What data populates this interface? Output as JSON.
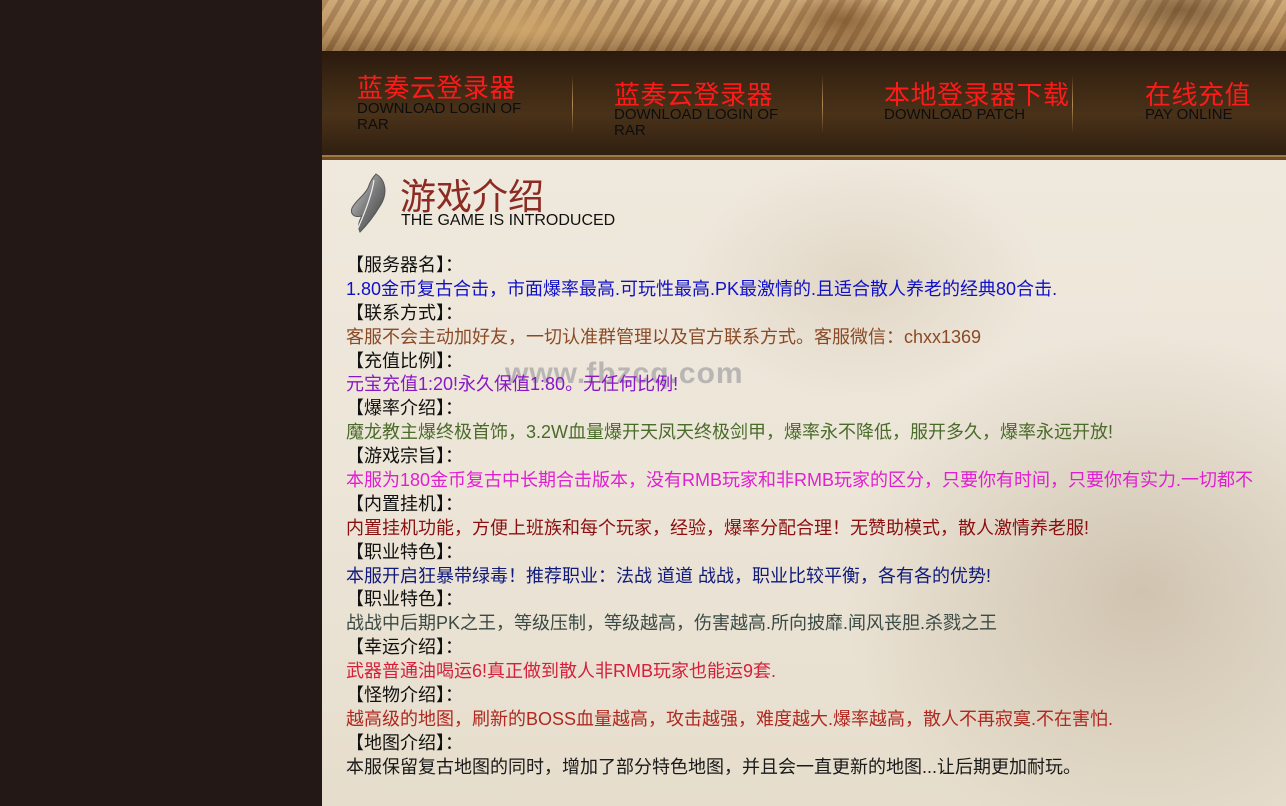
{
  "nav": {
    "items": [
      {
        "title": "蓝奏云登录器",
        "sub": "DOWNLOAD LOGIN OF RAR"
      },
      {
        "title": "蓝奏云登录器",
        "sub": "DOWNLOAD LOGIN OF RAR"
      },
      {
        "title": "本地登录器下载",
        "sub": "DOWNLOAD PATCH"
      },
      {
        "title": "在线充值",
        "sub": "PAY ONLINE"
      }
    ]
  },
  "section": {
    "title": "游戏介绍",
    "subtitle": "THE GAME IS INTRODUCED"
  },
  "watermark": "www.fbzcq.com",
  "info": [
    {
      "label": "【服务器名】：",
      "value": "1.80金币复古合击，市面爆率最高.可玩性最高.PK最激情的.且适合散人养老的经典80合击.",
      "color": "#1010c8"
    },
    {
      "label": "【联系方式】：",
      "value": "客服不会主动加好友，一切认准群管理以及官方联系方式。客服微信：chxx1369",
      "color": "#8b4a26"
    },
    {
      "label": "【充值比例】：",
      "value": "元宝充值1:20!永久保值1:80。无任何比例!",
      "color": "#8a16c8"
    },
    {
      "label": "【爆率介绍】：",
      "value": "魔龙教主爆终极首饰，3.2W血量爆开天凤天终极剑甲，爆率永不降低，服开多久，爆率永远开放!",
      "color": "#4a6b2a"
    },
    {
      "label": "【游戏宗旨】：",
      "value": "本服为180金币复古中长期合击版本，没有RMB玩家和非RMB玩家的区分，只要你有时间，只要你有实力.一切都不",
      "color": "#e020d0"
    },
    {
      "label": "【内置挂机】：",
      "value": "内置挂机功能，方便上班族和每个玩家，经验，爆率分配合理！无赞助模式，散人激情养老服!",
      "color": "#8b0f0f"
    },
    {
      "label": "【职业特色】：",
      "value": "本服开启狂暴带绿毒！推荐职业：法战 道道 战战，职业比较平衡，各有各的优势!",
      "color": "#101a7a"
    },
    {
      "label": "【职业特色】：",
      "value": "战战中后期PK之王，等级压制，等级越高，伤害越高.所向披靡.闻风丧胆.杀戮之王",
      "color": "#3a4a44"
    },
    {
      "label": "【幸运介绍】：",
      "value": "武器普通油喝运6!真正做到散人非RMB玩家也能运9套.",
      "color": "#d4203a"
    },
    {
      "label": "【怪物介绍】：",
      "value": "越高级的地图，刷新的BOSS血量越高，攻击越强，难度越大.爆率越高，散人不再寂寞.不在害怕.",
      "color": "#b02820"
    },
    {
      "label": "【地图介绍】：",
      "value": "本服保留复古地图的同时，增加了部分特色地图，并且会一直更新的地图...让后期更加耐玩。",
      "color": "#1a1a1a"
    }
  ]
}
